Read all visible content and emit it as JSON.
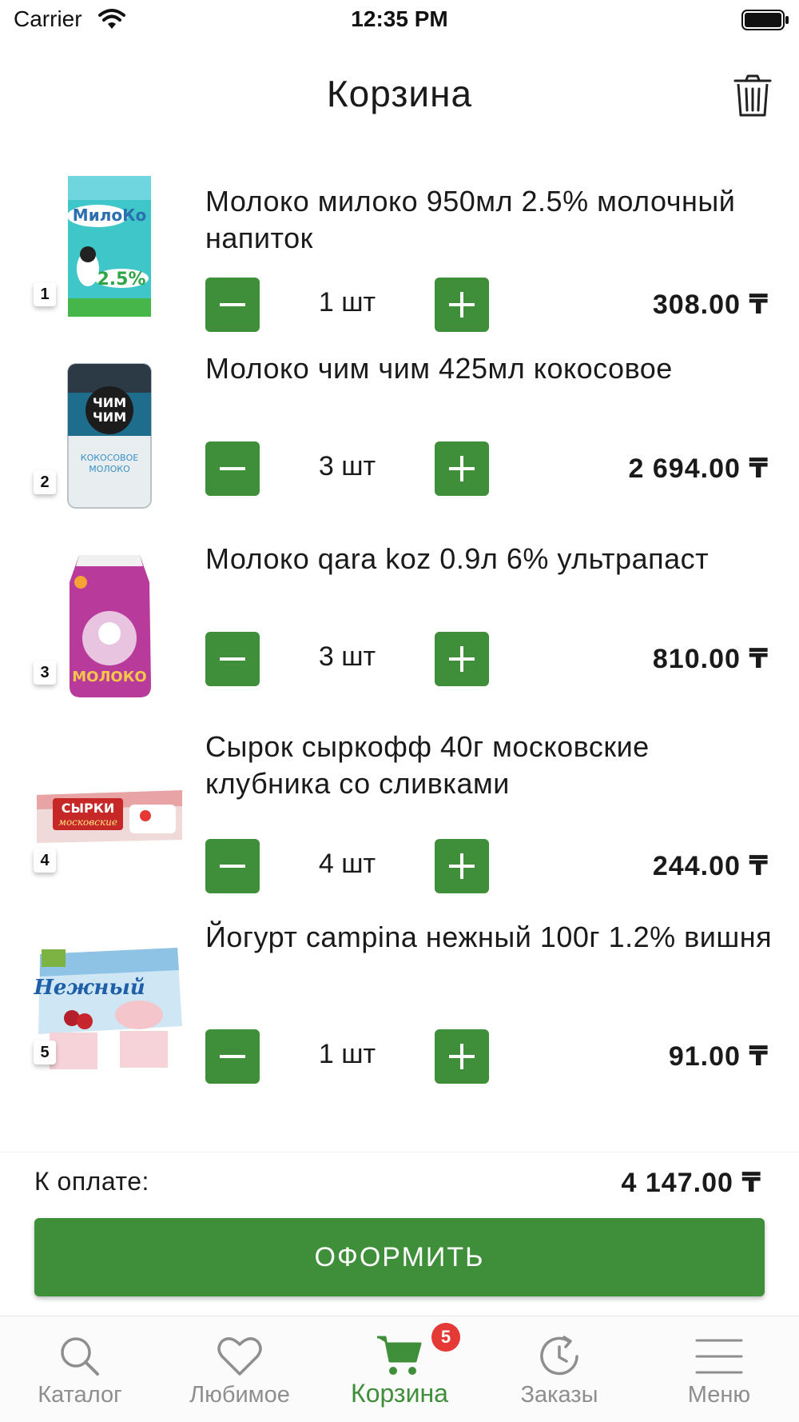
{
  "status_bar": {
    "carrier": "Carrier",
    "time": "12:35 PM"
  },
  "header": {
    "title": "Корзина",
    "trash_icon": "trash-icon"
  },
  "items": [
    {
      "index": "1",
      "name": "Молоко милоко 950мл 2.5% молочный напиток",
      "qty": "1 шт",
      "price": "308.00 ₸",
      "image": "milk-carton-image"
    },
    {
      "index": "2",
      "name": "Молоко чим чим 425мл кокосовое",
      "qty": "3 шт",
      "price": "2 694.00 ₸",
      "image": "coconut-milk-can-image"
    },
    {
      "index": "3",
      "name": "Молоко qara koz 0.9л 6% ультрапаст",
      "qty": "3 шт",
      "price": "810.00 ₸",
      "image": "milk-pack-image"
    },
    {
      "index": "4",
      "name": "Сырок сыркофф 40г московские клубника со сливками",
      "qty": "4 шт",
      "price": "244.00 ₸",
      "image": "cheese-bar-image"
    },
    {
      "index": "5",
      "name": "Йогурт campina нежный 100г 1.2% вишня",
      "qty": "1 шт",
      "price": "91.00 ₸",
      "image": "yogurt-pack-image"
    }
  ],
  "summary": {
    "total_label": "К оплате:",
    "total_value": "4 147.00 ₸",
    "checkout_label": "ОФОРМИТЬ"
  },
  "tabbar": {
    "tabs": [
      {
        "label": "Каталог",
        "icon": "search-icon"
      },
      {
        "label": "Любимое",
        "icon": "heart-icon"
      },
      {
        "label": "Корзина",
        "icon": "cart-icon",
        "active": true,
        "badge": "5"
      },
      {
        "label": "Заказы",
        "icon": "clock-icon"
      },
      {
        "label": "Меню",
        "icon": "menu-icon"
      }
    ]
  },
  "colors": {
    "accent": "#3f8e39",
    "badge": "#e53935",
    "inactive": "#8e8e8e"
  }
}
